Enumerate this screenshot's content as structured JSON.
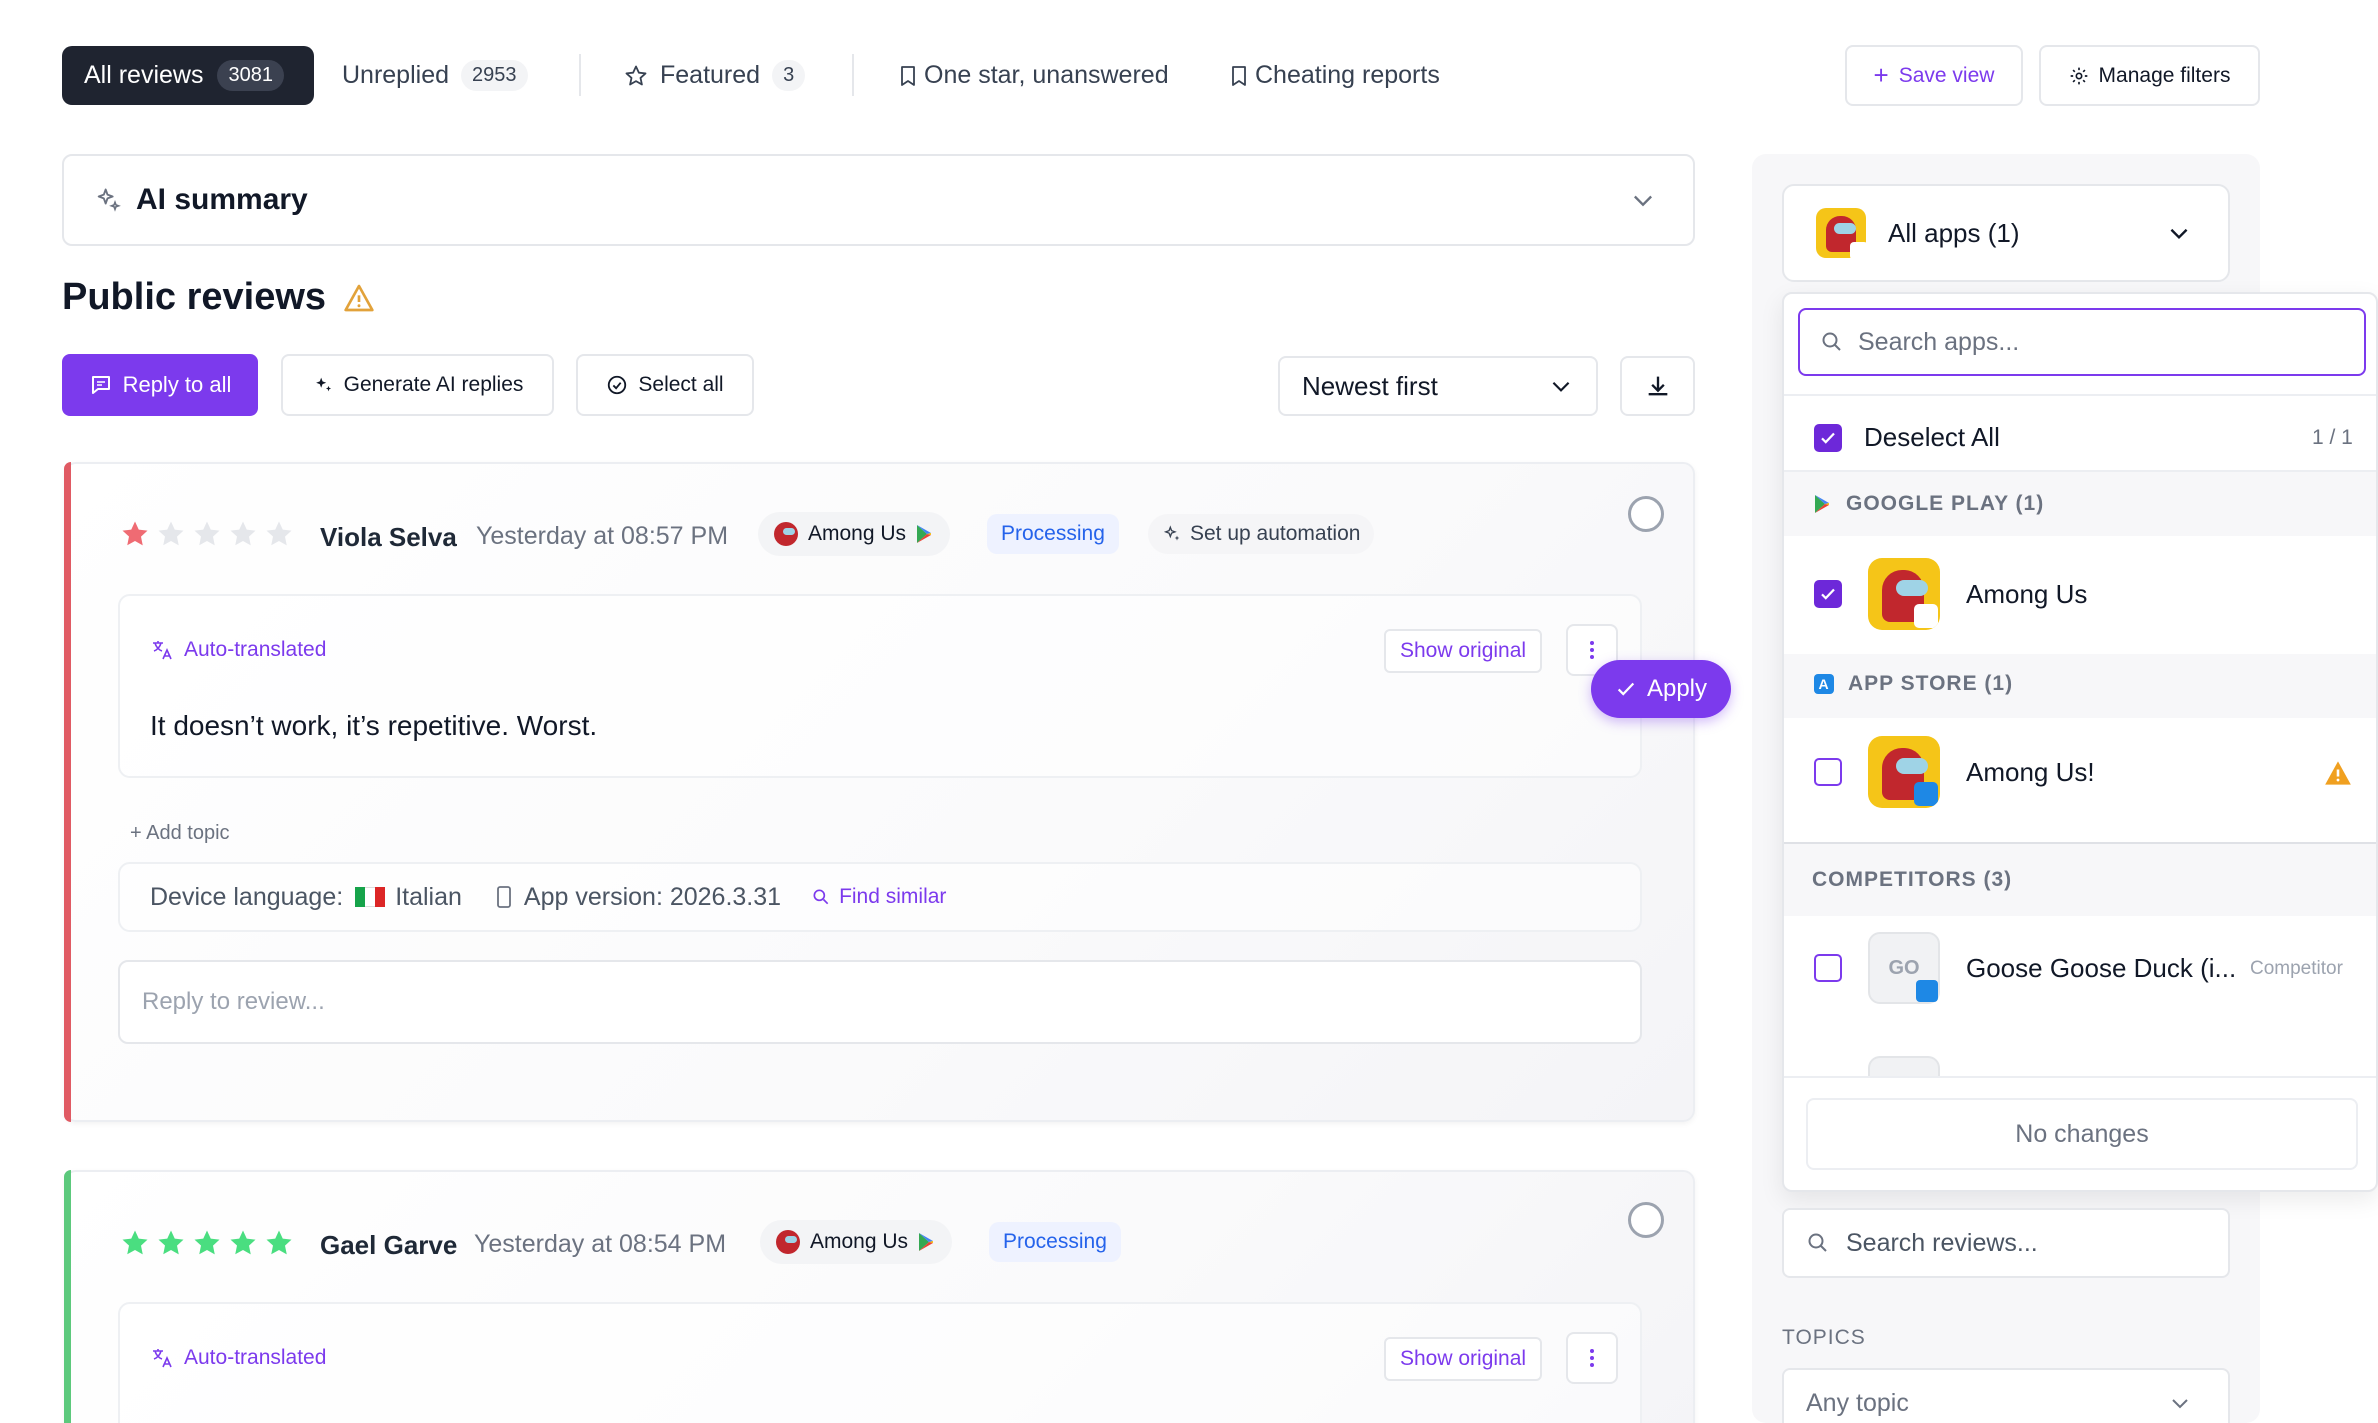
{
  "tabs": [
    {
      "label": "All reviews",
      "count": "3081"
    },
    {
      "label": "Unreplied",
      "count": "2953"
    },
    {
      "label": "Featured",
      "count": "3"
    },
    {
      "label": "One star, unanswered"
    },
    {
      "label": "Cheating reports"
    }
  ],
  "header_actions": {
    "save_view": "Save view",
    "manage_filters": "Manage filters"
  },
  "ai_summary": {
    "label": "AI summary"
  },
  "section": {
    "title": "Public reviews"
  },
  "toolbar": {
    "reply_all": "Reply to all",
    "generate_ai": "Generate AI replies",
    "select_all": "Select all",
    "sort": "Newest first"
  },
  "reviews": [
    {
      "rating": 1,
      "reviewer": "Viola Selva",
      "date": "Yesterday at 08:57 PM",
      "app": "Among Us",
      "status": "Processing",
      "automation": "Set up automation",
      "auto_translated": "Auto-translated",
      "show_original": "Show original",
      "text": "It doesn’t work, it’s repetitive. Worst.",
      "add_topic": "+ Add topic",
      "device_language_label": "Device language:",
      "device_language": "Italian",
      "app_version": "App version: 2026.3.31",
      "find_similar": "Find similar",
      "reply_placeholder": "Reply to review..."
    },
    {
      "rating": 5,
      "reviewer": "Gael Garve",
      "date": "Yesterday at 08:54 PM",
      "app": "Among Us",
      "status": "Processing",
      "auto_translated": "Auto-translated",
      "show_original": "Show original"
    }
  ],
  "apply_button": "Apply",
  "sidebar": {
    "app_select": "All apps (1)",
    "search_apps_placeholder": "Search apps...",
    "deselect_all": "Deselect All",
    "selection_count": "1 / 1",
    "groups": [
      {
        "name": "GOOGLE PLAY (1)",
        "items": [
          {
            "label": "Among Us",
            "checked": true
          }
        ]
      },
      {
        "name": "APP STORE (1)",
        "items": [
          {
            "label": "Among Us!",
            "checked": false,
            "warning": true
          }
        ]
      },
      {
        "name": "COMPETITORS (3)",
        "items": [
          {
            "label": "Goose Goose Duck (i...",
            "icon_text": "GO",
            "tag": "Competitor",
            "checked": false
          }
        ]
      }
    ],
    "no_changes": "No changes",
    "search_reviews": "Search reviews...",
    "topics_label": "TOPICS",
    "any_topic": "Any topic"
  },
  "colors": {
    "accent": "#7c3aed",
    "one_star_bar": "#e05a63",
    "five_star_bar": "#5cc97c",
    "star_red": "#ef6b73",
    "star_green": "#4ade80"
  }
}
